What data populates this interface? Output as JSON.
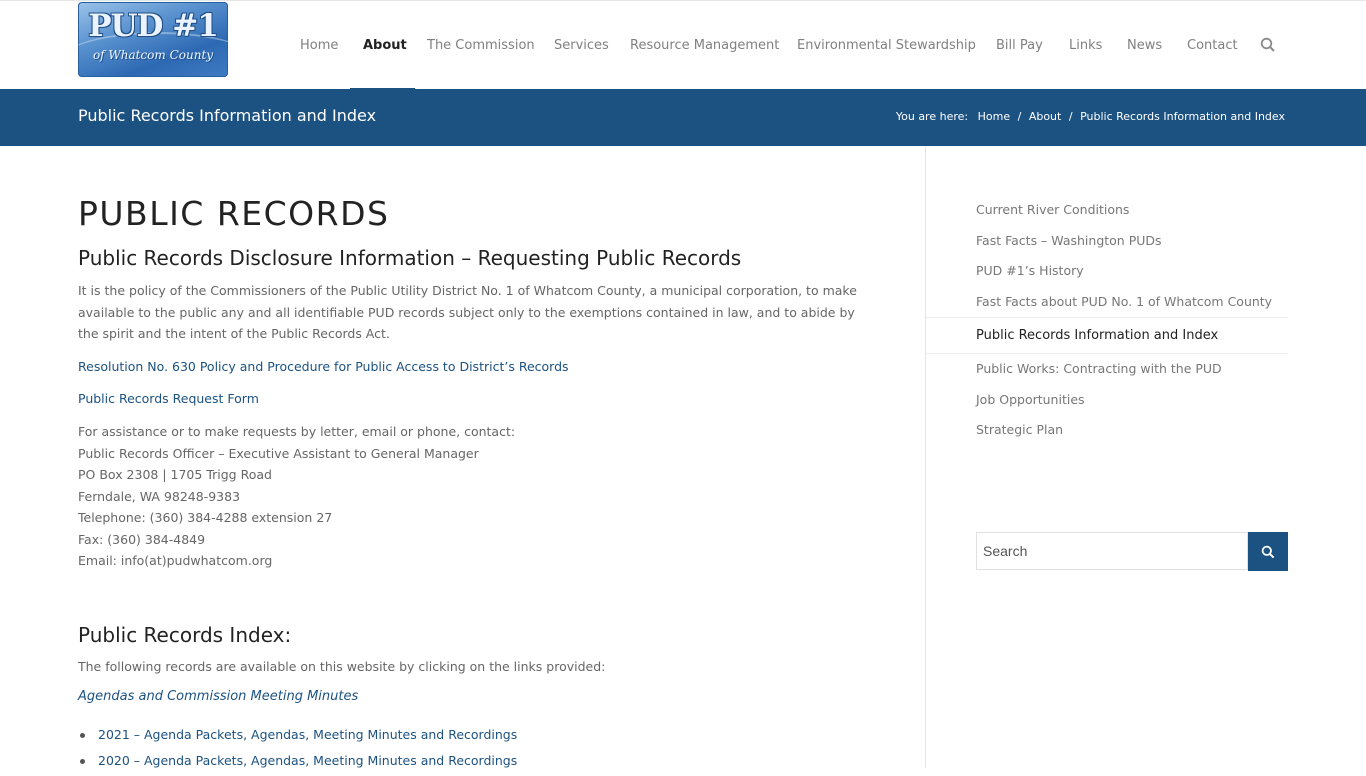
{
  "header": {
    "logo": {
      "main": "PUD #1",
      "sub": "of Whatcom County"
    },
    "nav": [
      {
        "label": "Home",
        "active": false
      },
      {
        "label": "About",
        "active": true
      },
      {
        "label": "The Commission",
        "active": false
      },
      {
        "label": "Services",
        "active": false
      },
      {
        "label": "Resource Management",
        "active": false
      },
      {
        "label": "Environmental Stewardship",
        "active": false
      },
      {
        "label": "Bill Pay",
        "active": false
      },
      {
        "label": "Links",
        "active": false
      },
      {
        "label": "News",
        "active": false
      },
      {
        "label": "Contact",
        "active": false
      }
    ],
    "search_icon": "search-icon"
  },
  "titlebar": {
    "title": "Public Records Information and Index",
    "breadcrumb": {
      "label": "You are here:",
      "items": [
        "Home",
        "About",
        "Public Records Information and Index"
      ],
      "separator": "/"
    }
  },
  "main": {
    "heading": "PUBLIC RECORDS",
    "subheading": "Public Records Disclosure Information – Requesting Public Records",
    "policy_text": "It is the policy of the Commissioners of the Public Utility District No. 1 of Whatcom County, a municipal corporation, to make available to the public any and all identifiable PUD records subject only to the exemptions contained in law, and to abide by the spirit and the intent of the Public Records Act.",
    "resolution_link": "Resolution No. 630 Policy and Procedure for Public Access to District’s Records",
    "request_form_link": "Public Records Request Form",
    "contact": {
      "intro": "For assistance or to make requests by letter, email or phone, contact:",
      "officer": "Public Records Officer – Executive Assistant to General Manager",
      "address": "PO Box 2308 | 1705 Trigg Road",
      "city": "Ferndale, WA  98248-9383",
      "telephone": "Telephone:  (360) 384-4288 extension 27",
      "fax": "Fax: (360) 384-4849",
      "email": "Email: info(at)pudwhatcom.org"
    },
    "index_heading": "Public Records Index:",
    "index_intro": "The following records are available on this website by clicking on the links provided:",
    "agendas_link": "Agendas and Commission Meeting Minutes",
    "records": [
      "2021 – Agenda Packets, Agendas, Meeting Minutes and Recordings",
      "2020 – Agenda Packets, Agendas, Meeting Minutes and Recordings"
    ]
  },
  "sidebar": {
    "items": [
      {
        "label": "Current River Conditions",
        "current": false
      },
      {
        "label": "Fast Facts – Washington PUDs",
        "current": false
      },
      {
        "label": "PUD #1’s History",
        "current": false
      },
      {
        "label": "Fast Facts about PUD No. 1 of Whatcom County",
        "current": false
      },
      {
        "label": "Public Records Information and Index",
        "current": true
      },
      {
        "label": "Public Works: Contracting with the PUD",
        "current": false
      },
      {
        "label": "Job Opportunities",
        "current": false
      },
      {
        "label": "Strategic Plan",
        "current": false
      }
    ],
    "search": {
      "placeholder": "Search"
    }
  },
  "colors": {
    "brand": "#1c5282",
    "text": "#666666",
    "heading": "#222222"
  }
}
